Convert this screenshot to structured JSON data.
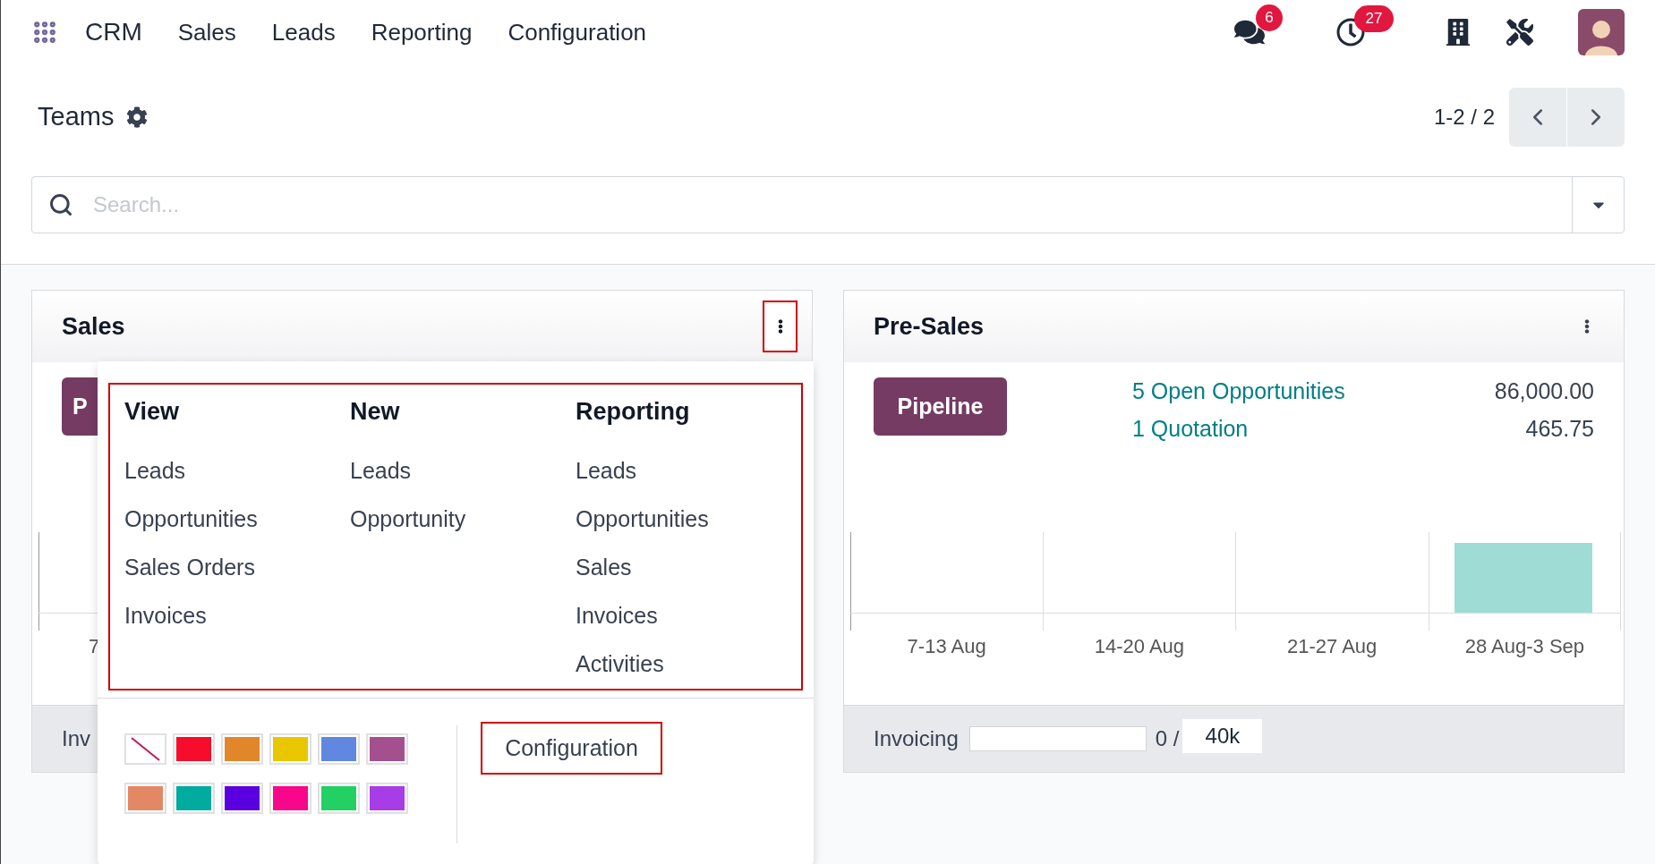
{
  "navbar": {
    "app": "CRM",
    "menu": [
      {
        "label": "Sales"
      },
      {
        "label": "Leads"
      },
      {
        "label": "Reporting"
      },
      {
        "label": "Configuration"
      }
    ],
    "messages_badge": "6",
    "activities_badge": "27"
  },
  "control_panel": {
    "title": "Teams",
    "pager": "1-2 / 2",
    "search": {
      "placeholder": "Search..."
    }
  },
  "teams": [
    {
      "kind": "covered",
      "name": "Sales",
      "pipeline_button": "P",
      "week_labels": [
        "7"
      ],
      "footer": {
        "label": "Inv"
      }
    },
    {
      "kind": "full",
      "name": "Pre-Sales",
      "pipeline_button": "Pipeline",
      "stats": [
        {
          "label": "5 Open Opportunities",
          "value": "86,000.00"
        },
        {
          "label": "1 Quotation",
          "value": "465.75"
        }
      ],
      "week_labels": [
        "7-13 Aug",
        "14-20 Aug",
        "21-27 Aug",
        "28 Aug-3 Sep"
      ],
      "footer": {
        "label": "Invoicing",
        "level": 0,
        "reading": "0 /",
        "target": "40k"
      }
    }
  ],
  "dropdown": {
    "sections": [
      {
        "title": "View",
        "items": [
          "Leads",
          "Opportunities",
          "Sales Orders",
          "Invoices"
        ]
      },
      {
        "title": "New",
        "items": [
          "Leads",
          "Opportunity"
        ]
      },
      {
        "title": "Reporting",
        "items": [
          "Leads",
          "Opportunities",
          "Sales",
          "Invoices",
          "Activities"
        ]
      }
    ],
    "colors": [
      {
        "kind": "none"
      },
      {
        "kind": "swatch",
        "color": "#f50d2b"
      },
      {
        "kind": "swatch",
        "color": "#e2862a"
      },
      {
        "kind": "swatch",
        "color": "#e8c600"
      },
      {
        "kind": "swatch",
        "color": "#6088e0"
      },
      {
        "kind": "swatch",
        "color": "#a4508f"
      },
      {
        "kind": "swatch",
        "color": "#e38864"
      },
      {
        "kind": "swatch",
        "color": "#00ab9f"
      },
      {
        "kind": "swatch",
        "color": "#5a00e0"
      },
      {
        "kind": "swatch",
        "color": "#f8078a"
      },
      {
        "kind": "swatch",
        "color": "#22d063"
      },
      {
        "kind": "swatch",
        "color": "#a83ce6"
      }
    ],
    "configuration": "Configuration"
  }
}
